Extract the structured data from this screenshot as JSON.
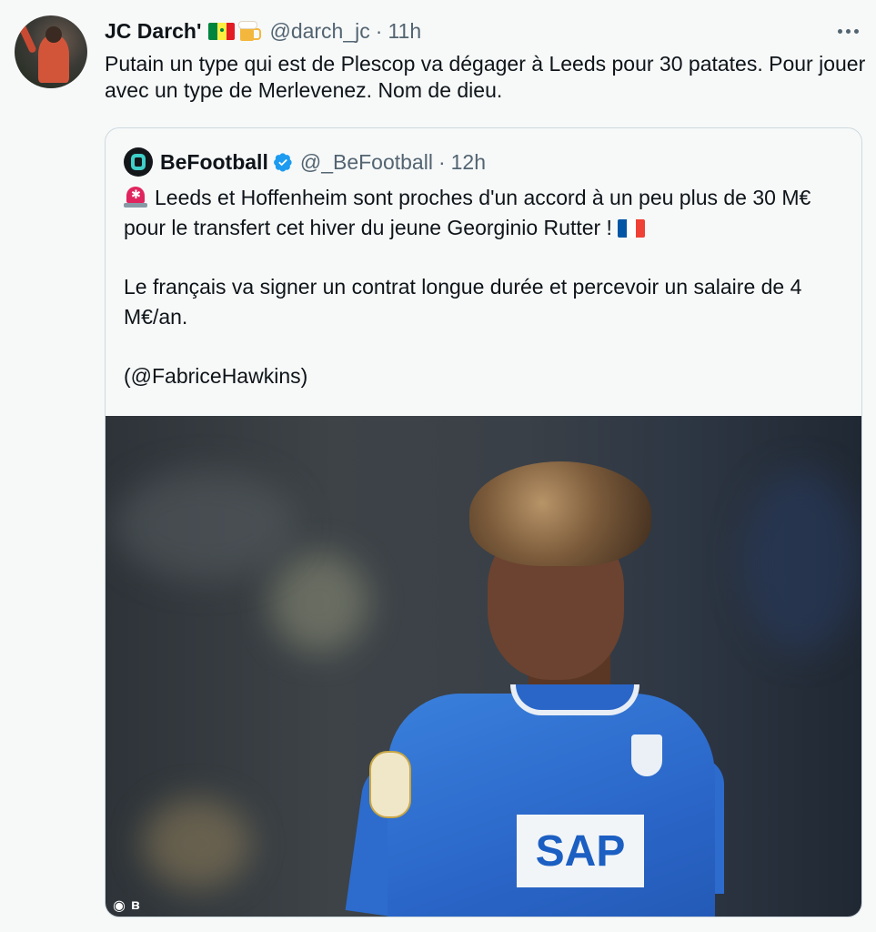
{
  "tweet": {
    "author_name": "JC Darch'",
    "author_emojis": [
      "senegal-flag",
      "beer-mug"
    ],
    "handle": "@darch_jc",
    "separator": "·",
    "time": "11h",
    "text": "Putain un type qui est de Plescop va dégager à Leeds pour 30 patates. Pour jouer avec un type de Merlevenez. Nom de dieu."
  },
  "quoted": {
    "author_name": "BeFootball",
    "verified": true,
    "handle": "@_BeFootball",
    "separator": "·",
    "time": "12h",
    "paragraph1": "Leeds et Hoffenheim sont proches d'un accord à un peu plus de 30 M€ pour le transfert cet hiver du jeune Georginio Rutter !",
    "paragraph2": "Le français va signer un contrat longue durée et percevoir un salaire de 4 M€/an.",
    "paragraph3": "(@FabriceHawkins)",
    "emoji_start": "police-light",
    "emoji_end": "france-flag",
    "image": {
      "description_icon": "player-photo",
      "sponsor_text": "SAP",
      "watermark_icons": [
        "camera-icon",
        "befootball-logo-icon"
      ]
    }
  },
  "colors": {
    "background": "#f7f9f9",
    "text": "#0f1419",
    "secondary_text": "#536471",
    "border": "#cfd9de",
    "verified": "#1d9bf0",
    "france_blue": "#0055a4",
    "france_white": "#ffffff",
    "france_red": "#ef4135"
  }
}
